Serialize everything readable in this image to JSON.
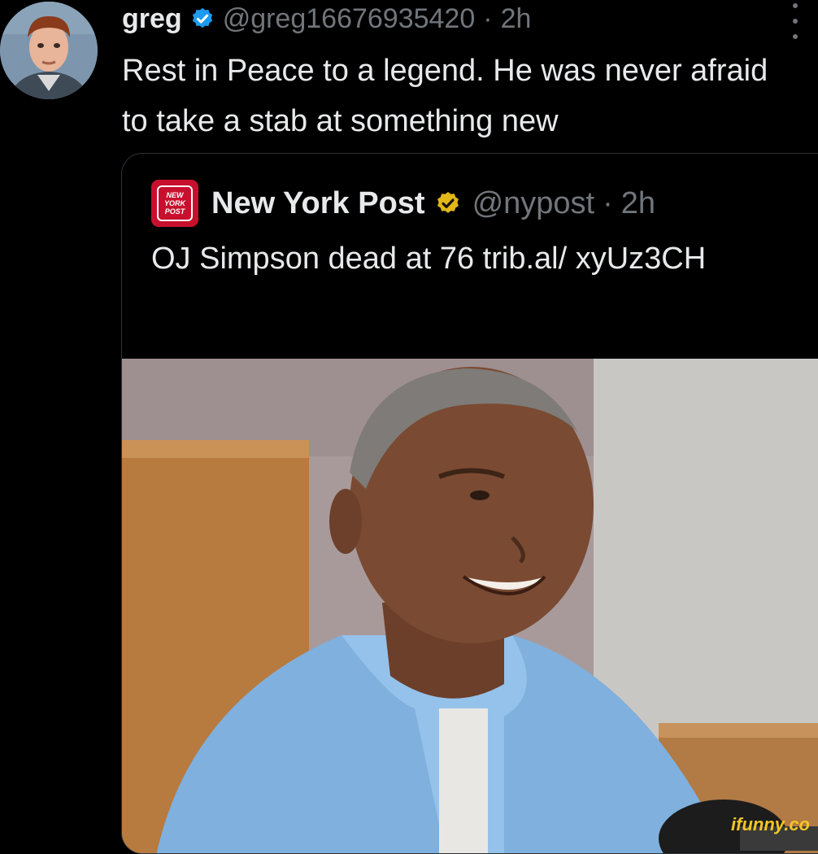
{
  "tweet": {
    "author": {
      "display_name": "greg",
      "handle": "@greg16676935420",
      "verified": true,
      "avatar": "profile-photo"
    },
    "separator": "·",
    "time": "2h",
    "text": "Rest in Peace to a legend. He was never afraid to take a stab at something new",
    "more_icon": "ellipsis-vertical-icon"
  },
  "quoted_tweet": {
    "author": {
      "display_name": "New York Post",
      "handle": "@nypost",
      "verified": true,
      "logo_text": [
        "NEW",
        "YORK",
        "POST"
      ]
    },
    "separator": "·",
    "time": "2h",
    "text": "OJ Simpson dead at 76 trib.al/ xyUz3CH",
    "image": "photo-of-smiling-man-in-blue-shirt"
  },
  "watermark": "ifunny.co",
  "colors": {
    "background": "#000000",
    "primary_text": "#e7e9ea",
    "secondary_text": "#71767b",
    "verified_blue": "#1d9bf0",
    "verified_gold": "#e2b719",
    "nypost_red": "#c8102e",
    "watermark": "#f3c624"
  }
}
